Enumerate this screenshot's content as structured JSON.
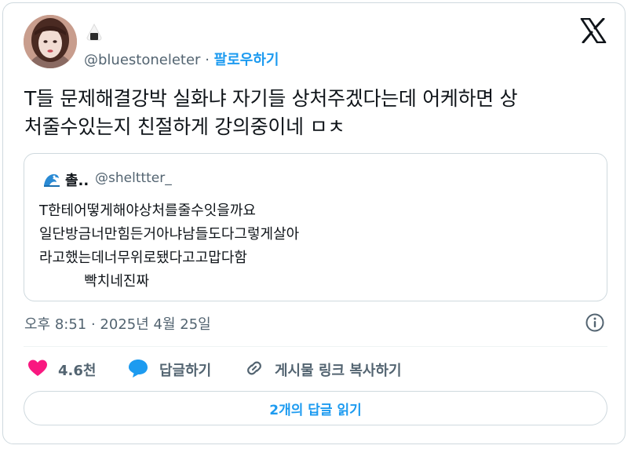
{
  "tweet": {
    "author_handle": "@bluestoneleter",
    "separator": "·",
    "follow_label": "팔로우하기",
    "name_emoji": "onigiri-emoji",
    "text_line1": "T들 문제해결강박 실화냐 자기들 상처주겠다는데 어케하면 상",
    "text_line2": "처줄수있는지 친절하게 강의중이네 ㅁㅊ",
    "timestamp": "오후 8:51 · 2025년 4월 25일"
  },
  "quote": {
    "emoji": "wave-emoji",
    "display_name": "촐..",
    "handle": "@shelttter_",
    "lines": [
      "T한테어떻게해야상처를줄수잇을까요",
      "일단방금너만힘든거아냐남들도다그렇게살아",
      "라고했는데너무위로됐다고고맙다함",
      "          빡치네진짜"
    ]
  },
  "actions": {
    "likes_count": "4.6천",
    "reply_label": "답글하기",
    "copy_link_label": "게시물 링크 복사하기"
  },
  "read_replies_label": "2개의 답글 읽기",
  "colors": {
    "accent": "#1d9bf0",
    "like": "#f91880",
    "text": "#0f1419",
    "muted": "#536471",
    "border": "#cfd9de"
  }
}
